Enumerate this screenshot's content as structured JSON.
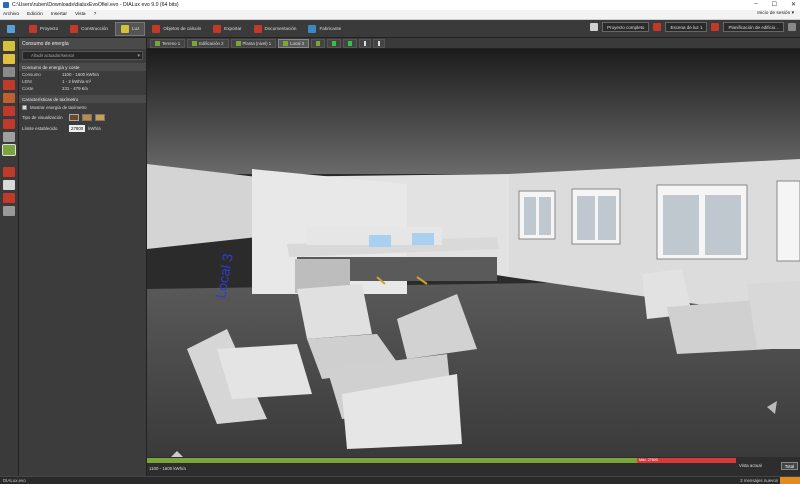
{
  "window": {
    "title": "C:\\Users\\ruben\\Downloads\\dialuxEvoOfiel.evo - DIALux evo 9.0  (64 bits)",
    "controls": [
      "–",
      "☐",
      "✕"
    ]
  },
  "menu": {
    "items": [
      "Archivo",
      "Edición",
      "Insertar",
      "Vista",
      "?"
    ],
    "session": "Inicio de sesión ▾"
  },
  "ribbon": {
    "tabs": [
      {
        "label": "Proyecto",
        "color": "#c0392b"
      },
      {
        "label": "Construcción",
        "color": "#c0392b"
      },
      {
        "label": "Luz",
        "color": "#d4c23a",
        "active": true
      },
      {
        "label": "Objetos de cálculo",
        "color": "#c0392b"
      },
      {
        "label": "Exportar",
        "color": "#c0392b"
      },
      {
        "label": "Documentación",
        "color": "#c0392b"
      },
      {
        "label": "Fabricante",
        "color": "#3a8ac0"
      }
    ],
    "right": {
      "project_status": "Proyecto completo",
      "light_scene": "Escena de luz 1",
      "planning": "Planificación de edificio..."
    }
  },
  "panel": {
    "header": "Consumo de energía",
    "input_placeholder": "Añadir actuador/sensor",
    "energy_section": "Consumo de energía y coste",
    "rows": [
      {
        "k": "Consumo",
        "v": "1100 - 1600 kWh/a"
      },
      {
        "k": "LENI",
        "v": "1 - 2 kWh/a·m²"
      },
      {
        "k": "Coste",
        "v": "231 - 479 €/a"
      }
    ],
    "meter_section": "Características de taxímetro",
    "show_meter": "Mostrar energía de taxímetro",
    "display_type": "Tipo de visualización",
    "limit_label": "Límite establecido",
    "limit_value": "27800",
    "limit_unit": "kWh/a"
  },
  "view_tabs": [
    "Terreno 1",
    "Edificación 2",
    "Planta (nivel) 1",
    "Local 3"
  ],
  "meter": {
    "range": "1100 - 1600 kWh/a",
    "max_label": "Máx. 27800",
    "view_label": "Vista actual",
    "total": "Total",
    "fill_fraction": 0.83
  },
  "status": {
    "file": "DIALux.evo",
    "messages": "3 mensajes nuevos"
  },
  "colors": {
    "accent_green": "#7aa53a",
    "accent_red": "#d83a3a",
    "orange": "#e38b1e"
  }
}
